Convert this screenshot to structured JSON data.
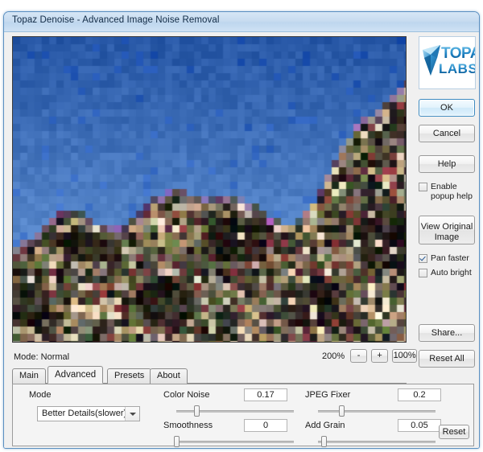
{
  "window": {
    "title": "Topaz Denoise - Advanced Image Noise Removal"
  },
  "preview": {
    "mode_label": "Mode: Normal",
    "image_description": "Blocky JPEG-artifacted photo of a rocky hillside under blue sky"
  },
  "zoom_controls": {
    "level": "200%",
    "zoom_out_label": "-",
    "zoom_in_label": "+",
    "fit_label": "100%"
  },
  "tabs": [
    {
      "label": "Main",
      "active": false
    },
    {
      "label": "Advanced",
      "active": true
    },
    {
      "label": "Presets",
      "active": false
    },
    {
      "label": "About",
      "active": false
    }
  ],
  "parameters": {
    "mode_group_label": "Mode",
    "mode_value": "Better Details(slower)",
    "reset_label": "Reset",
    "sliders": [
      {
        "label": "Color Noise",
        "value": "0.17",
        "fraction": 0.17
      },
      {
        "label": "Smoothness",
        "value": "0",
        "fraction": 0.0
      },
      {
        "label": "JPEG Fixer",
        "value": "0.2",
        "fraction": 0.2
      },
      {
        "label": "Add Grain",
        "value": "0.05",
        "fraction": 0.05
      }
    ]
  },
  "sidebar": {
    "logo_top_text": "TOPAZ",
    "logo_bottom_text": "LABS",
    "buttons": {
      "ok": "OK",
      "cancel": "Cancel",
      "help": "Help",
      "view_original": "View Original Image",
      "share": "Share...",
      "reset_all": "Reset All"
    },
    "checkboxes": [
      {
        "label": "Enable",
        "label2": "popup help",
        "checked": false
      },
      {
        "label": "Pan faster",
        "checked": true
      },
      {
        "label": "Auto bright",
        "checked": false
      }
    ]
  },
  "colors": {
    "accent": "#3c8ac0",
    "title_bar": "#c8dcf0",
    "sky_blue": "#2f64b4",
    "logo_blue": "#1a7fc1"
  }
}
